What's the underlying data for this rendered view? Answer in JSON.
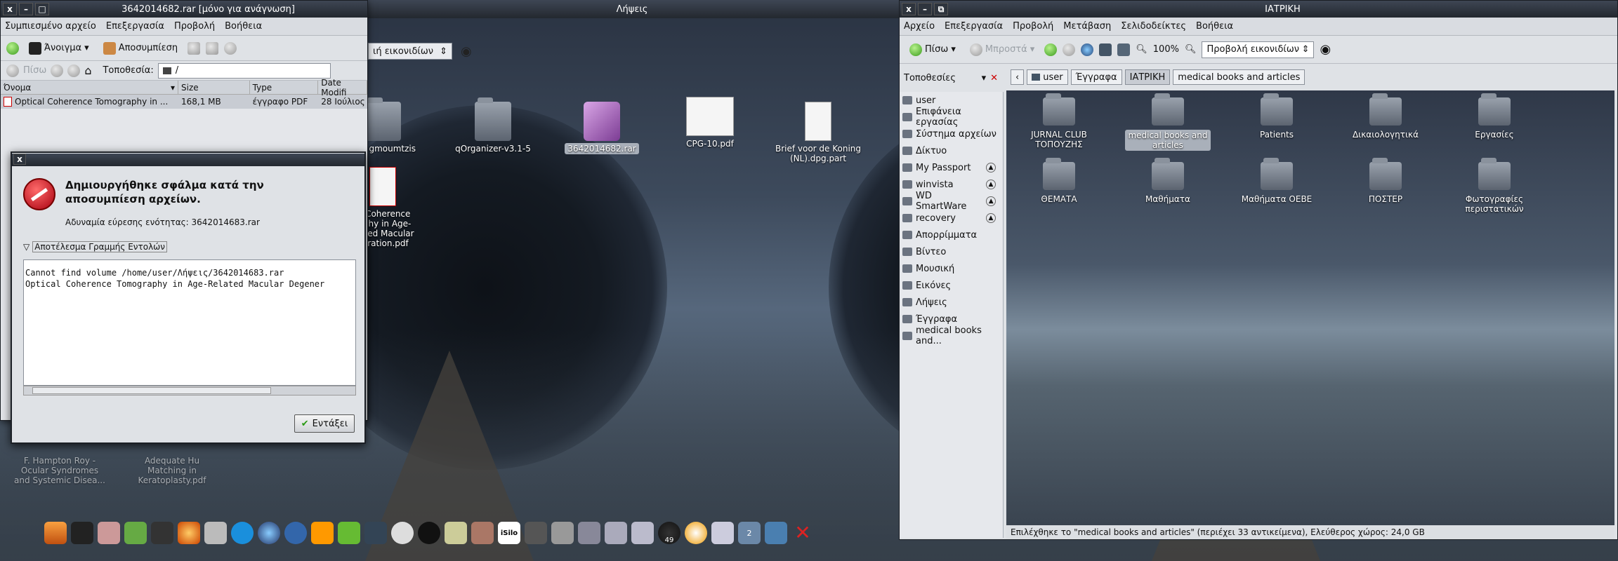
{
  "desktop": {
    "icons": [
      {
        "label": "rom gmoumtzis",
        "kind": "folder"
      },
      {
        "label": "qOrganizer-v3.1-5",
        "kind": "folder"
      },
      {
        "label": "3642014682.rar",
        "kind": "rar"
      },
      {
        "label": "CPG-10.pdf",
        "kind": "pdf"
      },
      {
        "label": "Brief voor de Koning (NL).dpg.part",
        "kind": "doc"
      },
      {
        "label": "al Coherence\nraphy in Age-\nelated Macular\nneration.pdf",
        "kind": "pdf"
      },
      {
        "label": "F. Hampton Roy -\nOcular Syndromes\nand Systemic Disea...",
        "kind": "faded"
      },
      {
        "label": "Adequate Hu\nMatching in\nKeratoplasty.pdf",
        "kind": "faded"
      }
    ],
    "behind_window": {
      "title": "Λήψεις",
      "view_combo": "ιή εικονιδίων"
    },
    "dock_badge": "49",
    "dock_badge2": "2",
    "dock_isilo": "iSilo"
  },
  "archive": {
    "title": "3642014682.rar [μόνο για ανάγνωση]",
    "menu": [
      "Συμπιεσμένο αρχείο",
      "Επεξεργασία",
      "Προβολή",
      "Βοήθεια"
    ],
    "toolbar": {
      "open": "Άνοιγμα",
      "extract": "Αποσυμπίεση"
    },
    "nav": {
      "back": "Πίσω",
      "location_label": "Τοποθεσία:",
      "location_value": "/"
    },
    "columns": [
      "Όνομα",
      "Size",
      "Type",
      "Date Modifi"
    ],
    "rows": [
      {
        "name": "Optical Coherence Tomography in ...",
        "size": "168,1 MB",
        "type": "έγγραφο PDF",
        "date": "28 Ιούλιος"
      }
    ]
  },
  "error_dialog": {
    "heading": "Δημιουργήθηκε σφάλμα κατά την αποσυμπίεση αρχείων.",
    "detail": "Αδυναμία εύρεσης ενότητας: 3642014683.rar",
    "expander": "Αποτέλεσμα Γραμμής Εντολών",
    "output": "Cannot find volume /home/user/Λήψεις/3642014683.rar\nOptical Coherence Tomography in Age-Related Macular Degener",
    "ok": "Εντάξει"
  },
  "filemanager": {
    "title": "ΙΑΤΡΙΚΗ",
    "menu": [
      "Αρχείο",
      "Επεξεργασία",
      "Προβολή",
      "Μετάβαση",
      "Σελιδοδείκτες",
      "Βοήθεια"
    ],
    "toolbar": {
      "back": "Πίσω",
      "forward": "Μπροστά",
      "zoom": "100%",
      "view": "Προβολή εικονιδίων"
    },
    "places_label": "Τοποθεσίες",
    "breadcrumb": [
      "user",
      "Έγγραφα",
      "ΙΑΤΡΙΚΗ",
      "medical books and articles"
    ],
    "sidebar": [
      {
        "label": "user",
        "eject": false
      },
      {
        "label": "Επιφάνεια εργασίας",
        "eject": false
      },
      {
        "label": "Σύστημα αρχείων",
        "eject": false
      },
      {
        "label": "Δίκτυο",
        "eject": false
      },
      {
        "label": "My Passport",
        "eject": true
      },
      {
        "label": "winvista",
        "eject": true
      },
      {
        "label": "WD SmartWare",
        "eject": true
      },
      {
        "label": "recovery",
        "eject": true
      },
      {
        "label": "Απορρίμματα",
        "eject": false
      },
      {
        "label": "Βίντεο",
        "eject": false
      },
      {
        "label": "Μουσική",
        "eject": false
      },
      {
        "label": "Εικόνες",
        "eject": false
      },
      {
        "label": "Λήψεις",
        "eject": false
      },
      {
        "label": "Έγγραφα",
        "eject": false
      },
      {
        "label": "medical books and...",
        "eject": false
      }
    ],
    "folders": [
      "JURNAL CLUB\nΤΟΠΟΥΖΗΣ",
      "medical books and\narticles",
      "Patients",
      "Δικαιολογητικά",
      "Εργασίες",
      "ΘΕΜΑΤΑ",
      "Μαθήματα",
      "Μαθήματα ΟΕΒΕ",
      "ΠΟΣΤΕΡ",
      "Φωτογραφίες\nπεριστατικών"
    ],
    "status": "Επιλέχθηκε το \"medical books and articles\" (περιέχει 33 αντικείμενα), Ελεύθερος χώρος: 24,0 GB"
  },
  "colors": {
    "selection": "#a9b0ba",
    "error_red": "#c8102e",
    "titlebar": "#2b3038"
  }
}
